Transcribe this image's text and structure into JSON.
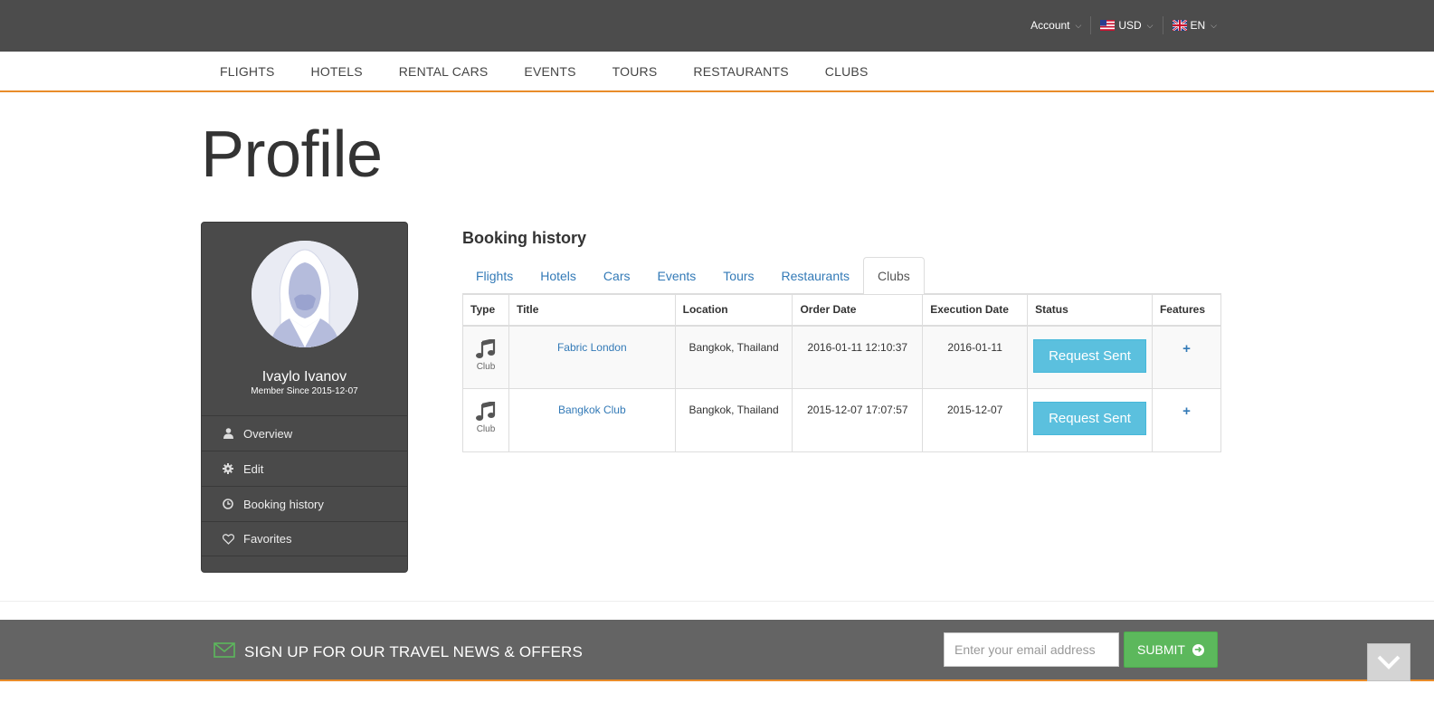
{
  "topbar": {
    "account_label": "Account",
    "currency_label": "USD",
    "language_label": "EN"
  },
  "mainnav": {
    "items": [
      "FLIGHTS",
      "HOTELS",
      "RENTAL CARS",
      "EVENTS",
      "TOURS",
      "RESTAURANTS",
      "CLUBS"
    ]
  },
  "page": {
    "title": "Profile"
  },
  "profile": {
    "name": "Ivaylo Ivanov",
    "member_since": "Member Since 2015-12-07",
    "menu": [
      {
        "label": "Overview",
        "icon": "user-icon"
      },
      {
        "label": "Edit",
        "icon": "gear-icon"
      },
      {
        "label": "Booking history",
        "icon": "clock-icon"
      },
      {
        "label": "Favorites",
        "icon": "heart-icon"
      }
    ]
  },
  "booking": {
    "title": "Booking history",
    "tabs": [
      "Flights",
      "Hotels",
      "Cars",
      "Events",
      "Tours",
      "Restaurants",
      "Clubs"
    ],
    "active_tab": "Clubs",
    "columns": [
      "Type",
      "Title",
      "Location",
      "Order Date",
      "Execution Date",
      "Status",
      "Features"
    ],
    "rows": [
      {
        "type": "Club",
        "title": "Fabric London",
        "location": "Bangkok, Thailand",
        "order_date": "2016-01-11 12:10:37",
        "execution_date": "2016-01-11",
        "status": "Request Sent",
        "features": "+"
      },
      {
        "type": "Club",
        "title": "Bangkok Club",
        "location": "Bangkok, Thailand",
        "order_date": "2015-12-07 17:07:57",
        "execution_date": "2015-12-07",
        "status": "Request Sent",
        "features": "+"
      }
    ]
  },
  "newsletter": {
    "text": "SIGN UP FOR OUR TRAVEL NEWS & OFFERS",
    "placeholder": "Enter your email address",
    "submit_label": "SUBMIT"
  },
  "colors": {
    "topbar_bg": "#4c4c4c",
    "accent_orange": "#e98c2a",
    "link_blue": "#337ab7",
    "status_info": "#5bc0de",
    "submit_green": "#5cb85c"
  }
}
